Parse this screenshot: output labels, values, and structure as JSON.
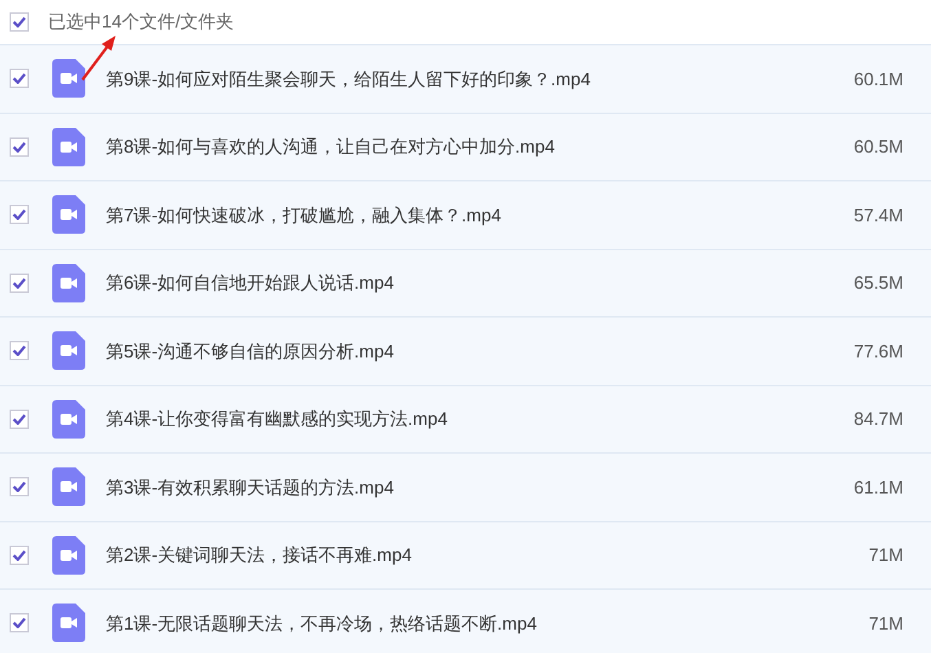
{
  "header": {
    "checked": true,
    "label": "已选中14个文件/文件夹"
  },
  "files": [
    {
      "name": "第9课-如何应对陌生聚会聊天，给陌生人留下好的印象？.mp4",
      "size": "60.1M",
      "checked": true
    },
    {
      "name": "第8课-如何与喜欢的人沟通，让自己在对方心中加分.mp4",
      "size": "60.5M",
      "checked": true
    },
    {
      "name": "第7课-如何快速破冰，打破尴尬，融入集体？.mp4",
      "size": "57.4M",
      "checked": true
    },
    {
      "name": "第6课-如何自信地开始跟人说话.mp4",
      "size": "65.5M",
      "checked": true
    },
    {
      "name": "第5课-沟通不够自信的原因分析.mp4",
      "size": "77.6M",
      "checked": true
    },
    {
      "name": "第4课-让你变得富有幽默感的实现方法.mp4",
      "size": "84.7M",
      "checked": true
    },
    {
      "name": "第3课-有效积累聊天话题的方法.mp4",
      "size": "61.1M",
      "checked": true
    },
    {
      "name": "第2课-关键词聊天法，接话不再难.mp4",
      "size": "71M",
      "checked": true
    },
    {
      "name": "第1课-无限话题聊天法，不再冷场，热络话题不断.mp4",
      "size": "71M",
      "checked": true
    }
  ]
}
